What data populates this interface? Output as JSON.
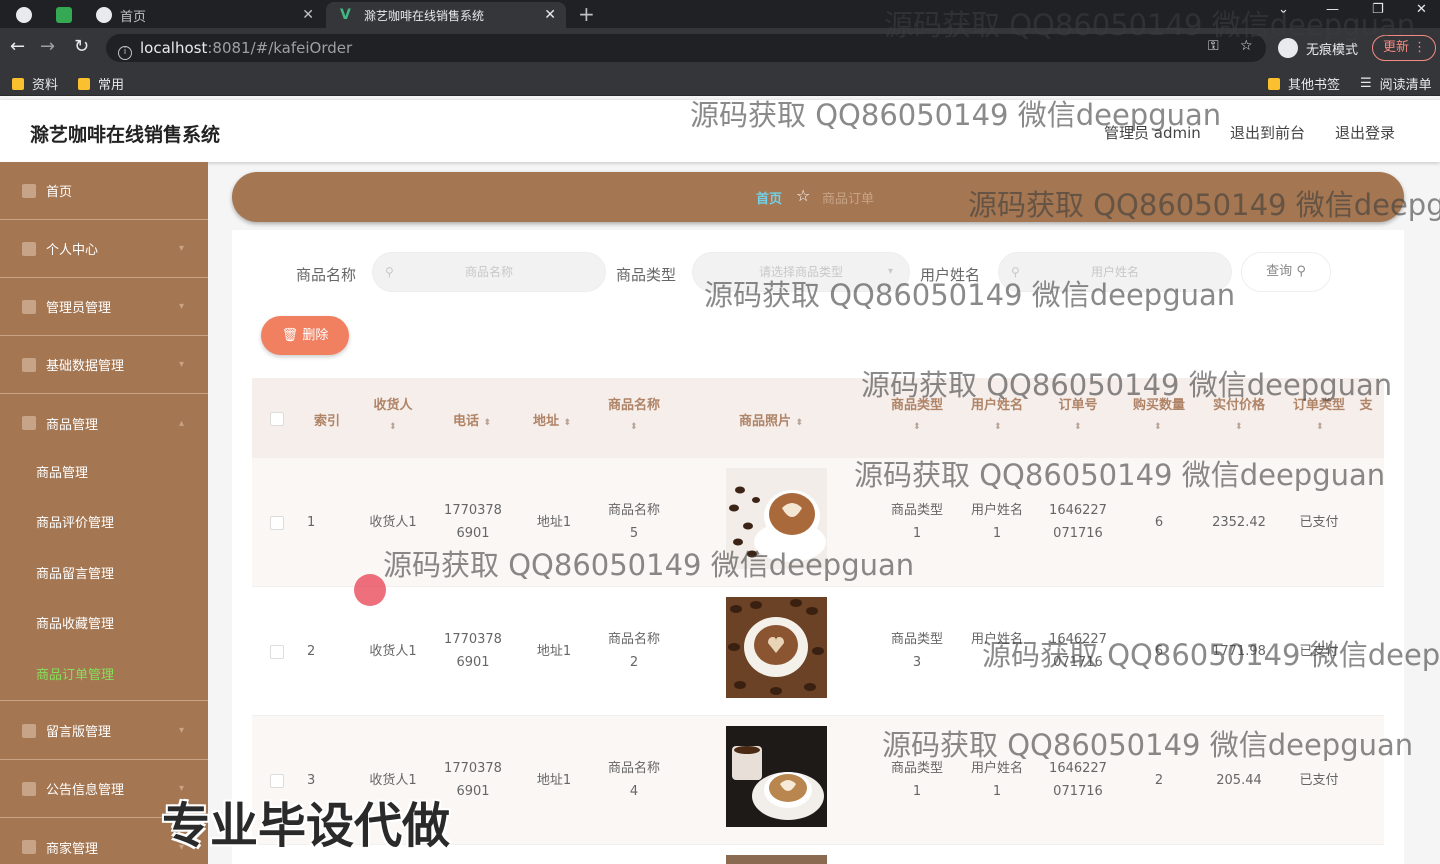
{
  "browser": {
    "tabs": [
      {
        "title": "首页"
      },
      {
        "title": "滁艺咖啡在线销售系统"
      }
    ],
    "url_host": "localhost",
    "url_rest": ":8081/#/kafeiOrder",
    "incognito_label": "无痕模式",
    "update_label": "更新",
    "bookmarks": [
      "资料",
      "常用"
    ],
    "bookmarks_right": [
      "其他书签",
      "阅读清单"
    ]
  },
  "header": {
    "title": "滁艺咖啡在线销售系统",
    "user": "管理员 admin",
    "to_front": "退出到前台",
    "logout": "退出登录"
  },
  "sidebar": {
    "items": [
      {
        "label": "首页"
      },
      {
        "label": "个人中心"
      },
      {
        "label": "管理员管理"
      },
      {
        "label": "基础数据管理"
      },
      {
        "label": "商品管理"
      }
    ],
    "sub_items": [
      {
        "label": "商品管理"
      },
      {
        "label": "商品评价管理"
      },
      {
        "label": "商品留言管理"
      },
      {
        "label": "商品收藏管理"
      },
      {
        "label": "商品订单管理"
      }
    ],
    "after_items": [
      {
        "label": "留言版管理"
      },
      {
        "label": "公告信息管理"
      },
      {
        "label": "商家管理"
      }
    ]
  },
  "breadcrumb": {
    "home": "首页",
    "current": "商品订单"
  },
  "search": {
    "name_label": "商品名称",
    "name_placeholder": "商品名称",
    "type_label": "商品类型",
    "type_placeholder": "请选择商品类型",
    "user_label": "用户姓名",
    "user_placeholder": "用户姓名",
    "query_label": "查询"
  },
  "actions": {
    "delete_label": "删除"
  },
  "table": {
    "headers": [
      "索引",
      "收货人",
      "电话",
      "地址",
      "商品名称",
      "商品照片",
      "商品类型",
      "用户姓名",
      "订单号",
      "购买数量",
      "实付价格",
      "订单类型",
      "支"
    ],
    "rows": [
      {
        "index": "1",
        "receiver": "收货人1",
        "phone1": "1770378",
        "phone2": "6901",
        "address": "地址1",
        "name1": "商品名称",
        "name2": "5",
        "type1": "商品类型",
        "type2": "1",
        "user1": "用户姓名",
        "user2": "1",
        "order1": "1646227",
        "order2": "071716",
        "qty": "6",
        "price": "2352.42",
        "status": "已支付"
      },
      {
        "index": "2",
        "receiver": "收货人1",
        "phone1": "1770378",
        "phone2": "6901",
        "address": "地址1",
        "name1": "商品名称",
        "name2": "2",
        "type1": "商品类型",
        "type2": "3",
        "user1": "用户姓名",
        "user2": "",
        "order1": "1646227",
        "order2": "071716",
        "qty": "6",
        "price": "1771.98",
        "status": "已支付"
      },
      {
        "index": "3",
        "receiver": "收货人1",
        "phone1": "1770378",
        "phone2": "6901",
        "address": "地址1",
        "name1": "商品名称",
        "name2": "4",
        "type1": "商品类型",
        "type2": "1",
        "user1": "用户姓名",
        "user2": "1",
        "order1": "1646227",
        "order2": "071716",
        "qty": "2",
        "price": "205.44",
        "status": "已支付"
      }
    ]
  },
  "overlay": {
    "watermark": "源码获取 QQ86050149 微信deepguan",
    "promo": "专业毕设代做"
  },
  "colors": {
    "sidebar": "#a47652",
    "active_sub": "#86e05b",
    "delete": "#f08060"
  }
}
